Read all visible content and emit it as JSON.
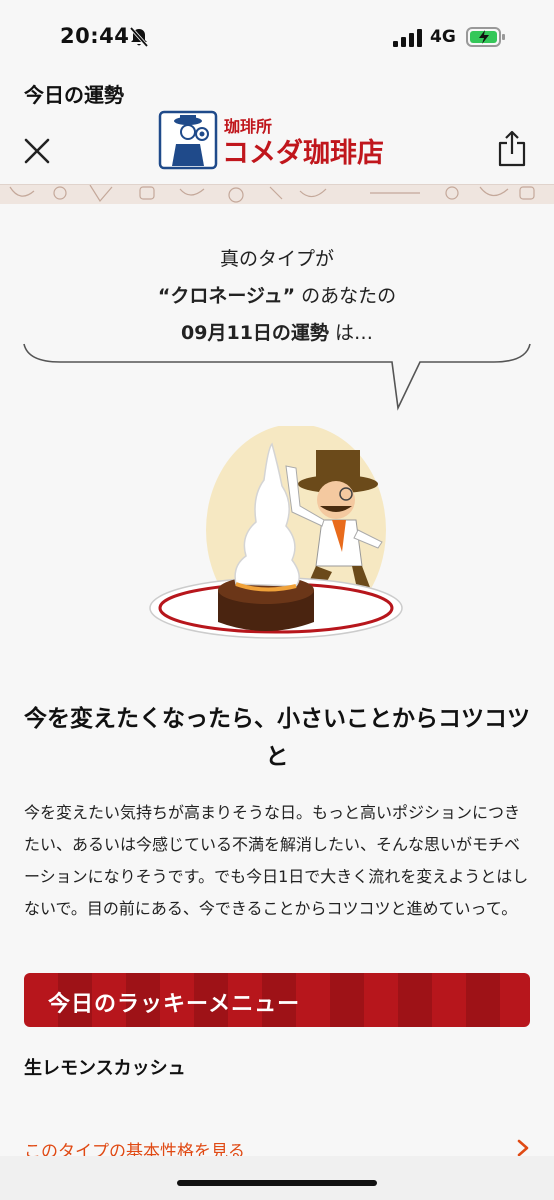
{
  "status_bar": {
    "time": "20:44",
    "network": "4G"
  },
  "header": {
    "page_title": "今日の運勢",
    "logo_text_small": "珈琲所",
    "logo_text_large": "コメダ珈琲店"
  },
  "intro": {
    "line1": "真のタイプが",
    "type_name": "“クロネージュ”",
    "line2_suffix": " のあなたの",
    "date_label": "09月11日の運勢",
    "line3_suffix": " は…"
  },
  "fortune": {
    "headline": "今を変えたくなったら、小さいことからコツコツと",
    "body": "今を変えたい気持ちが高まりそうな日。もっと高いポジションにつきたい、あるいは今感じている不満を解消したい、そんな思いがモチベーションになりそうです。でも今日1日で大きく流れを変えようとはしないで。目の前にある、今できることからコツコツと進めていって。"
  },
  "lucky_menu": {
    "title": "今日のラッキーメニュー",
    "item": "生レモンスカッシュ"
  },
  "links": {
    "type_link": "このタイプの基本性格を見る"
  },
  "colors": {
    "accent_red": "#b7161c",
    "link_orange": "#e04a14",
    "battery_green": "#34c759"
  },
  "icons": [
    "bell-slash-icon",
    "signal-icon",
    "battery-charging-icon",
    "close-icon",
    "share-icon",
    "chevron-right-icon"
  ]
}
